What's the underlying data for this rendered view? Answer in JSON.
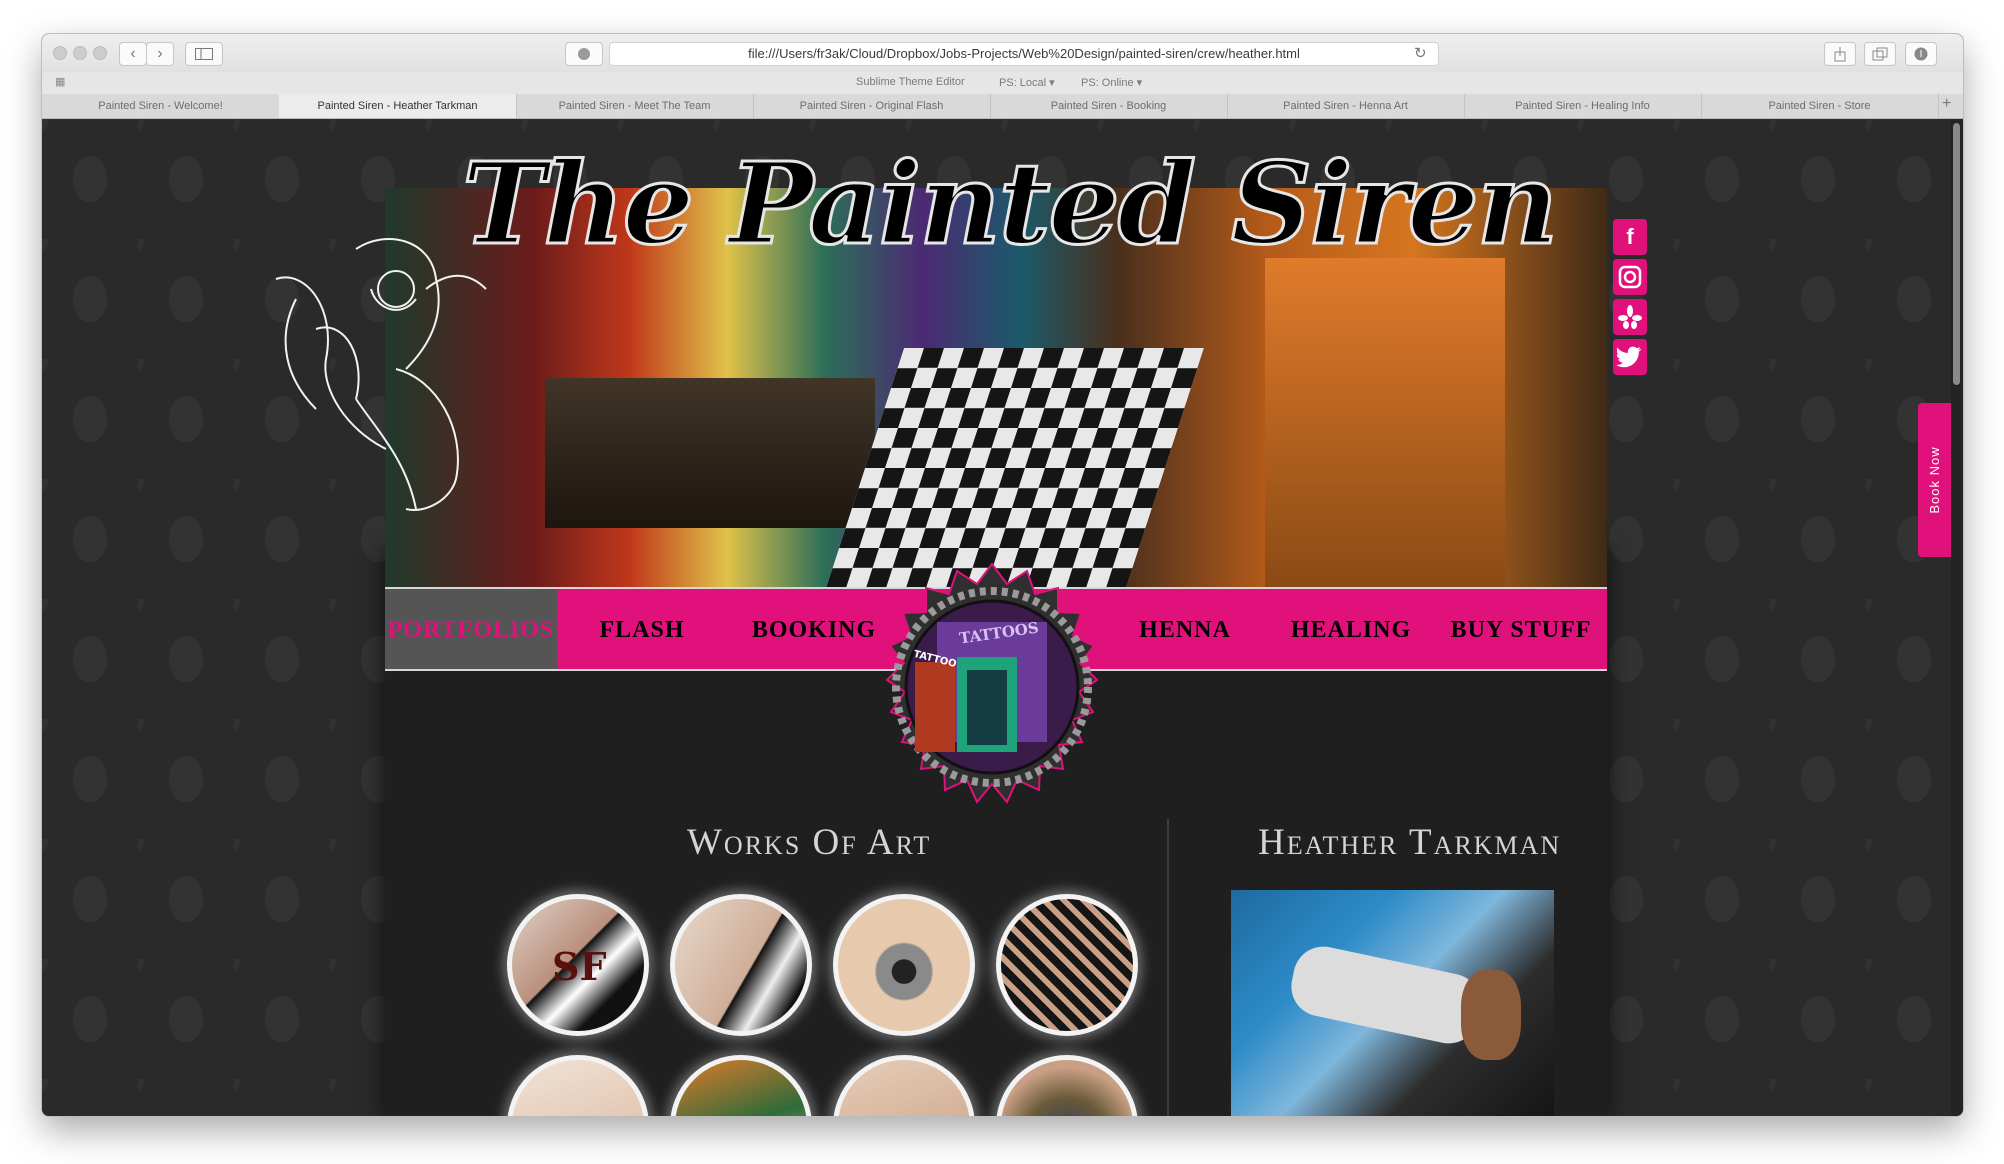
{
  "browser": {
    "url": "file:///Users/fr3ak/Cloud/Dropbox/Jobs-Projects/Web%20Design/painted-siren/crew/heather.html",
    "favorites": [
      "Sublime Theme Editor",
      "PS: Local",
      "PS: Online"
    ],
    "tabs": [
      {
        "label": "Painted Siren - Welcome!"
      },
      {
        "label": "Painted Siren - Heather Tarkman"
      },
      {
        "label": "Painted Siren - Meet The Team"
      },
      {
        "label": "Painted Siren - Original Flash"
      },
      {
        "label": "Painted Siren - Booking"
      },
      {
        "label": "Painted Siren - Henna Art"
      },
      {
        "label": "Painted Siren - Healing Info"
      },
      {
        "label": "Painted Siren - Store"
      }
    ],
    "active_tab": 1,
    "new_tab": "+"
  },
  "site": {
    "brand": "The Painted Siren",
    "nav": [
      {
        "label": "PORTFOLIOS"
      },
      {
        "label": "FLASH"
      },
      {
        "label": "BOOKING"
      },
      {
        "label": "HENNA"
      },
      {
        "label": "HEALING"
      },
      {
        "label": "BUY STUFF"
      }
    ],
    "nav_active": 0,
    "emblem_sign": "TATTOOS",
    "emblem_tag": "TATTOO",
    "social": [
      "facebook-icon",
      "instagram-icon",
      "yelp-icon",
      "twitter-icon"
    ],
    "book_now": "Book Now",
    "works_heading": "Works Of Art",
    "artist_heading": "Heather Tarkman"
  },
  "colors": {
    "accent": "#e0117a",
    "page_bg": "#2b2b2b",
    "content_bg": "#1f1f1f",
    "nav_active_bg": "#555555"
  }
}
